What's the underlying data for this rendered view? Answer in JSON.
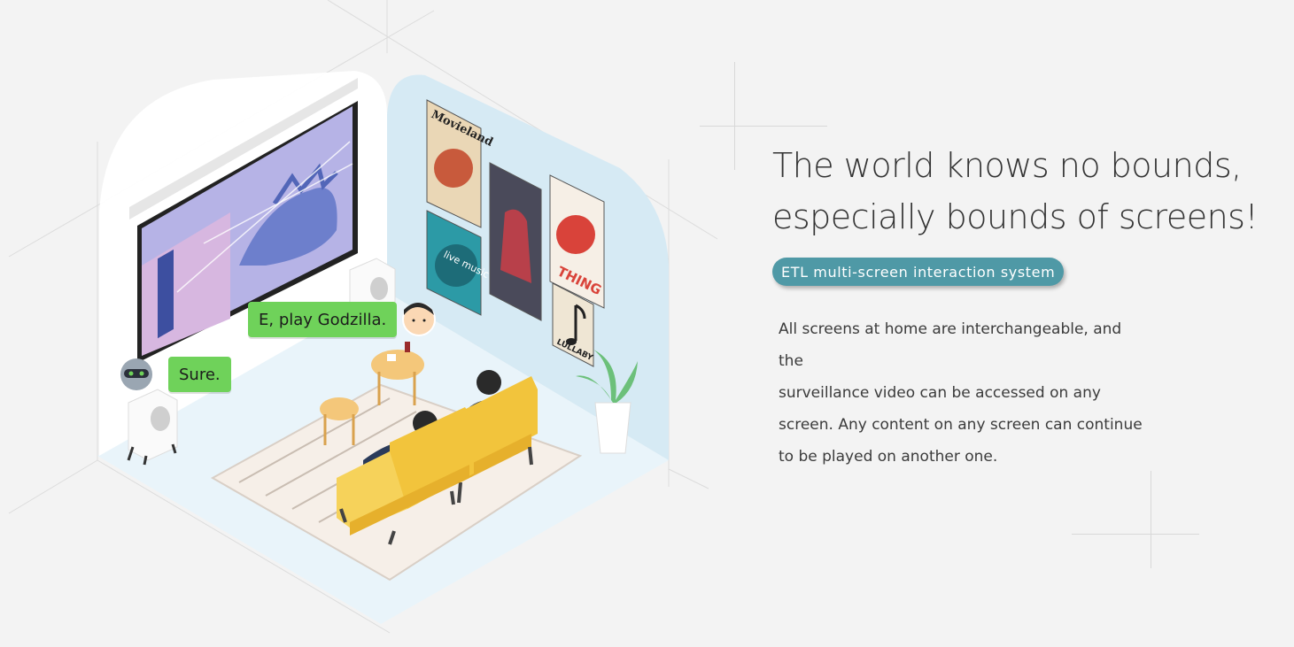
{
  "illustration": {
    "speech_user": "E, play Godzilla.",
    "speech_assistant": "Sure.",
    "poster_movieland": "Movieland",
    "poster_live_music": "live music",
    "poster_thing": "THING",
    "poster_lullaby": "LULLABY"
  },
  "content": {
    "headline_line1": "The world knows no bounds,",
    "headline_line2": "especially bounds of screens!",
    "badge": "ETL multi-screen interaction system",
    "body_lines": [
      "All screens at home are interchangeable, and the",
      "surveillance video can be accessed on any",
      "screen. Any content on any screen can continue",
      "to be played on another one."
    ]
  },
  "colors": {
    "background": "#f3f3f3",
    "badge": "#4f99a6",
    "bubble": "#6fd25a",
    "wall": "#d6eaf4",
    "sofa": "#f2c43c"
  }
}
